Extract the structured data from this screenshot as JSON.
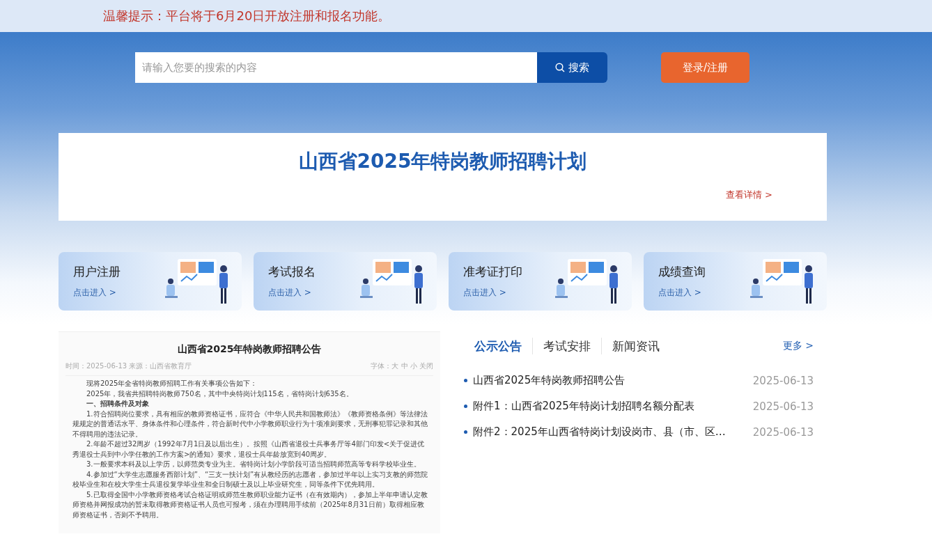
{
  "notice": "温馨提示：平台将于6月20日开放注册和报名功能。",
  "search": {
    "placeholder": "请输入您要的搜索的内容",
    "button": "搜索"
  },
  "login_button": "登录/注册",
  "banner": {
    "title": "山西省2025年特岗教师招聘计划",
    "link": "查看详情 >"
  },
  "cards": [
    {
      "title": "用户注册",
      "link": "点击进入 >"
    },
    {
      "title": "考试报名",
      "link": "点击进入 >"
    },
    {
      "title": "准考证打印",
      "link": "点击进入 >"
    },
    {
      "title": "成绩查询",
      "link": "点击进入 >"
    }
  ],
  "document": {
    "title": "山西省2025年特岗教师招聘公告",
    "meta": "时间：2025-06-13 来源：山西省教育厅",
    "font_size": "字体：大 中 小 关闭",
    "paragraphs": [
      {
        "kind": "text",
        "text": "现将2025年全省特岗教师招聘工作有关事项公告如下："
      },
      {
        "kind": "text",
        "text": "2025年，我省共招聘特岗教师750名，其中中央特岗计划115名，省特岗计划635名。"
      },
      {
        "kind": "heading",
        "text": "一、招聘条件及对象"
      },
      {
        "kind": "text",
        "text": "1.符合招聘岗位要求，具有相应的教师资格证书，应符合《中华人民共和国教师法》《教师资格条例》等法律法规规定的普通话水平、身体条件和心理条件，符合新时代中小学教师职业行为十项准则要求，无刑事犯罪记录和其他不得聘用的违法记录。"
      },
      {
        "kind": "text",
        "text": "2.年龄不超过32周岁（1992年7月1日及以后出生）。按照《山西省退役士兵事务厅等4部门印发<关于促进优秀退役士兵到中小学任教的工作方案>的通知》要求，退役士兵年龄放宽到40周岁。"
      },
      {
        "kind": "text",
        "text": "3.一般要求本科及以上学历，以师范类专业为主。省特岗计划小学阶段可适当招聘师范高等专科学校毕业生。"
      },
      {
        "kind": "text",
        "text": "4.参加过“大学生志愿服务西部计划”、“三支一扶计划”有从教经历的志愿者，参加过半年以上实习支教的师范院校毕业生和在校大学生士兵退役复学毕业生和全日制硕士及以上毕业研究生，同等条件下优先聘用。"
      },
      {
        "kind": "text",
        "text": "5.已取得全国中小学教师资格考试合格证明或师范生教师职业能力证书（在有效期内），参加上半年申请认定教师资格并网报成功的暂未取得教师资格证书人员也可报考，须在办理聘用手续前（2025年8月31日前）取得相应教师资格证书，否则不予聘用。"
      }
    ]
  },
  "news": {
    "tabs": [
      {
        "label": "公示公告",
        "selected": true
      },
      {
        "label": "考试安排",
        "selected": false
      },
      {
        "label": "新闻资讯",
        "selected": false
      }
    ],
    "more": "更多 >",
    "items": [
      {
        "title": "山西省2025年特岗教师招聘公告",
        "date": "2025-06-13"
      },
      {
        "title": "附件1：山西省2025年特岗计划招聘名额分配表",
        "date": "2025-06-13"
      },
      {
        "title": "附件2：2025年山西省特岗计划设岗市、县（市、区…",
        "date": "2025-06-13"
      }
    ]
  }
}
